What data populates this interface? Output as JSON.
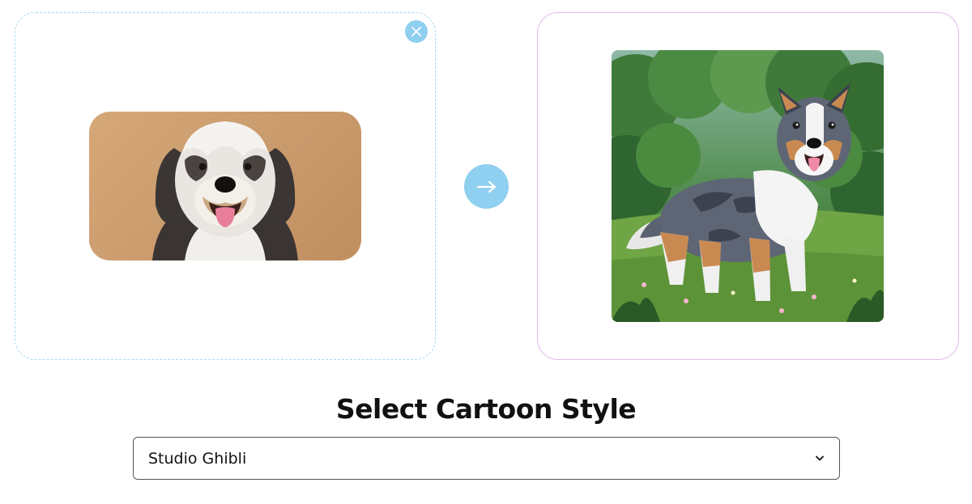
{
  "upload_panel": {
    "close_icon": "close-icon",
    "photo_subject": "dog-photo"
  },
  "convert": {
    "icon": "arrow-right-icon",
    "accent_color": "#8fcff0"
  },
  "result_panel": {
    "image_subject": "cartoon-dog-image"
  },
  "style_section": {
    "title": "Select Cartoon Style",
    "selected_value": "Studio Ghibli",
    "dropdown_icon": "chevron-down-icon"
  },
  "colors": {
    "upload_border": "#a8d9ee",
    "result_border": "#e3b8ec",
    "accent": "#8fcff0"
  }
}
